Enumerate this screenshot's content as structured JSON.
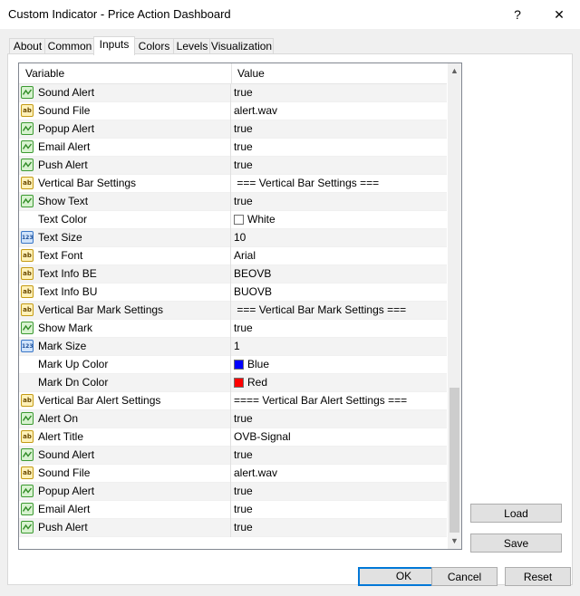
{
  "window": {
    "title": "Custom Indicator - Price Action Dashboard",
    "help_glyph": "?",
    "close_glyph": "✕"
  },
  "tabs": [
    {
      "label": "About"
    },
    {
      "label": "Common"
    },
    {
      "label": "Inputs"
    },
    {
      "label": "Colors"
    },
    {
      "label": "Levels"
    },
    {
      "label": "Visualization"
    }
  ],
  "active_tab": "Inputs",
  "grid": {
    "headers": {
      "variable": "Variable",
      "value": "Value"
    },
    "rows": [
      {
        "variable": "Sound Alert",
        "value": "true",
        "type": "bool"
      },
      {
        "variable": "Sound File",
        "value": "alert.wav",
        "type": "str"
      },
      {
        "variable": "Popup Alert",
        "value": "true",
        "type": "bool"
      },
      {
        "variable": "Email Alert",
        "value": "true",
        "type": "bool"
      },
      {
        "variable": "Push Alert",
        "value": "true",
        "type": "bool"
      },
      {
        "variable": "Vertical Bar Settings",
        "value": " === Vertical Bar Settings ===",
        "type": "str"
      },
      {
        "variable": "Show Text",
        "value": "true",
        "type": "bool"
      },
      {
        "variable": "Text Color",
        "value": "White",
        "type": "color",
        "color": "#ffffff"
      },
      {
        "variable": "Text Size",
        "value": "10",
        "type": "num"
      },
      {
        "variable": "Text Font",
        "value": "Arial",
        "type": "str"
      },
      {
        "variable": "Text Info BE",
        "value": "BEOVB",
        "type": "str"
      },
      {
        "variable": "Text Info BU",
        "value": "BUOVB",
        "type": "str"
      },
      {
        "variable": "Vertical Bar Mark Settings",
        "value": " === Vertical Bar Mark Settings ===",
        "type": "str"
      },
      {
        "variable": "Show Mark",
        "value": "true",
        "type": "bool"
      },
      {
        "variable": "Mark Size",
        "value": "1",
        "type": "num"
      },
      {
        "variable": "Mark Up Color",
        "value": "Blue",
        "type": "color",
        "color": "#0000ff"
      },
      {
        "variable": "Mark Dn Color",
        "value": "Red",
        "type": "color",
        "color": "#ff0000"
      },
      {
        "variable": "Vertical Bar Alert Settings",
        "value": "==== Vertical Bar Alert Settings ===",
        "type": "str"
      },
      {
        "variable": "Alert On",
        "value": "true",
        "type": "bool"
      },
      {
        "variable": "Alert Title",
        "value": "OVB-Signal",
        "type": "str"
      },
      {
        "variable": "Sound Alert",
        "value": "true",
        "type": "bool"
      },
      {
        "variable": "Sound File",
        "value": "alert.wav",
        "type": "str"
      },
      {
        "variable": "Popup Alert",
        "value": "true",
        "type": "bool"
      },
      {
        "variable": "Email Alert",
        "value": "true",
        "type": "bool"
      },
      {
        "variable": "Push Alert",
        "value": "true",
        "type": "bool"
      }
    ],
    "scroll_position_fraction": 1.0
  },
  "side_buttons": {
    "load": "Load",
    "save": "Save"
  },
  "footer": {
    "ok": "OK",
    "cancel": "Cancel",
    "reset": "Reset"
  },
  "icon_text": {
    "str": "ab",
    "num": "123"
  },
  "colors": {
    "accent": "#0078d7",
    "tab_border": "#d9d9d9",
    "grid_border": "#828790"
  }
}
